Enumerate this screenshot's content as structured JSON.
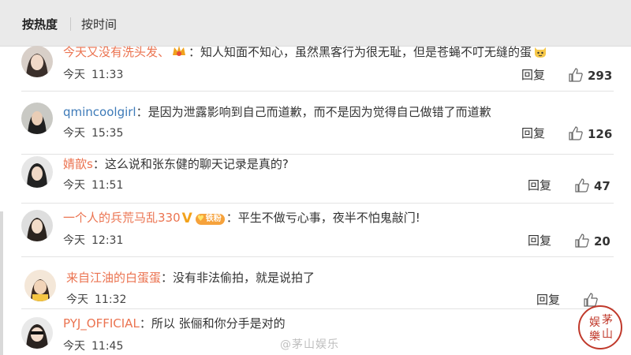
{
  "sort": {
    "hot_label": "按热度",
    "time_label": "按时间"
  },
  "comments": [
    {
      "user": "今天又没有洗头发、",
      "text": "：知人知面不知心，虽然黑客行为很无耻，但是苍蝇不叮无缝的蛋",
      "day": "今天",
      "time": "11:33",
      "reply": "回复",
      "likes": "293"
    },
    {
      "user": "qmincoolgirl",
      "text": "：是因为泄露影响到自己而道歉，而不是因为觉得自己做错了而道歉",
      "day": "今天",
      "time": "15:35",
      "reply": "回复",
      "likes": "126"
    },
    {
      "user": "婧歆s",
      "text": "：这么说和张东健的聊天记录是真的?",
      "day": "今天",
      "time": "11:51",
      "reply": "回复",
      "likes": "47"
    },
    {
      "user": "一个人的兵荒马乱330",
      "badge_text": "铁粉",
      "text": "：平生不做亏心事，夜半不怕鬼敲门!",
      "day": "今天",
      "time": "12:31",
      "reply": "回复",
      "likes": "20"
    },
    {
      "user": "来自江油的白蛋蛋",
      "text": "：没有非法偷拍，就是说拍了",
      "day": "今天",
      "time": "11:32",
      "reply": "回复",
      "likes": ""
    },
    {
      "user": "PYJ_OFFICIAL",
      "text": "：所以 张俪和你分手是对的",
      "day": "今天",
      "time": "11:45",
      "reply": "",
      "likes": ""
    }
  ],
  "watermark": "@茅山娱乐",
  "seal_text": [
    "娱",
    "茅",
    "樂",
    "山"
  ],
  "colors": {
    "username": "#eb7350",
    "username_blue": "#3d7ab8",
    "topbar": "#eaeaea"
  }
}
